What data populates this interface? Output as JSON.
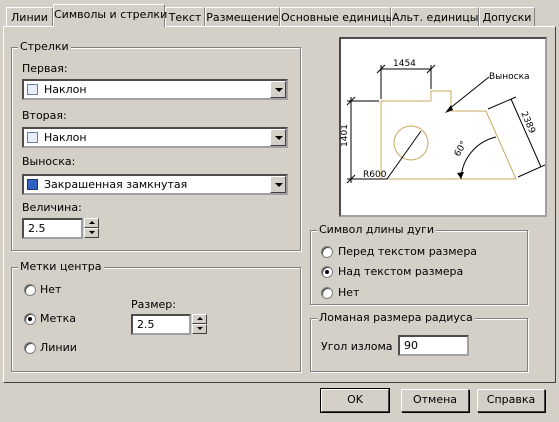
{
  "tabs": [
    {
      "label": "Линии"
    },
    {
      "label": "Символы и стрелки"
    },
    {
      "label": "Текст"
    },
    {
      "label": "Размещение"
    },
    {
      "label": "Основные единицы"
    },
    {
      "label": "Альт. единицы"
    },
    {
      "label": "Допуски"
    }
  ],
  "arrows": {
    "title": "Стрелки",
    "first_label": "Первая:",
    "first_value": "Наклон",
    "second_label": "Вторая:",
    "second_value": "Наклон",
    "leader_label": "Выноска:",
    "leader_value": "Закрашенная замкнутая",
    "size_label": "Величина:",
    "size_value": "2.5"
  },
  "center_marks": {
    "title": "Метки центра",
    "options": [
      "Нет",
      "Метка",
      "Линии"
    ],
    "selected": "Метка",
    "size_label": "Размер:",
    "size_value": "2.5"
  },
  "preview": {
    "dim_top": "1454",
    "dim_left": "1401",
    "dim_right": "2389",
    "angle": "60°",
    "radius": "R600",
    "leader": "Выноска"
  },
  "arc_length": {
    "title": "Символ длины дуги",
    "options": [
      "Перед текстом размера",
      "Над текстом размера",
      "Нет"
    ],
    "selected": "Над текстом размера"
  },
  "jog": {
    "title": "Ломаная размера радиуса",
    "angle_label": "Угол излома",
    "angle_value": "90"
  },
  "buttons": {
    "ok": "OK",
    "cancel": "Отмена",
    "help": "Справка"
  }
}
